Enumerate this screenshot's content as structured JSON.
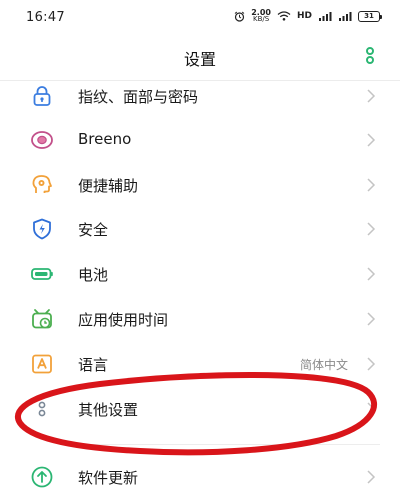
{
  "status_bar": {
    "time": "16:47",
    "net_speed_value": "2.00",
    "net_speed_unit": "KB/S",
    "hd_label": "HD",
    "battery": "31",
    "icons": [
      "alarm-icon",
      "wifi-icon",
      "signal-icon",
      "battery-icon"
    ]
  },
  "header": {
    "title": "设置",
    "more_icon": "more-vertical-icon"
  },
  "settings": {
    "items": [
      {
        "label": "指纹、面部与密码",
        "icon": "lock-icon",
        "icon_color": "#3b7de0",
        "value": ""
      },
      {
        "label": "Breeno",
        "icon": "breeno-icon",
        "icon_color": "#c2508a",
        "value": ""
      },
      {
        "label": "便捷辅助",
        "icon": "assist-icon",
        "icon_color": "#f2a13a",
        "value": ""
      },
      {
        "label": "安全",
        "icon": "shield-icon",
        "icon_color": "#2f6fd8",
        "value": ""
      },
      {
        "label": "电池",
        "icon": "battery-icon",
        "icon_color": "#2bb673",
        "value": ""
      },
      {
        "label": "应用使用时间",
        "icon": "screen-time-icon",
        "icon_color": "#4caf50",
        "value": ""
      },
      {
        "label": "语言",
        "icon": "language-icon",
        "icon_color": "#f2a13a",
        "value": "简体中文"
      },
      {
        "label": "其他设置",
        "icon": "more-settings-icon",
        "icon_color": "#7a8796",
        "value": ""
      },
      {
        "label": "软件更新",
        "icon": "update-icon",
        "icon_color": "#2bb673",
        "value": ""
      }
    ]
  },
  "colors": {
    "annotation": "#d9151a",
    "accent_green": "#2bb673",
    "chevron": "#c4c4c4"
  }
}
